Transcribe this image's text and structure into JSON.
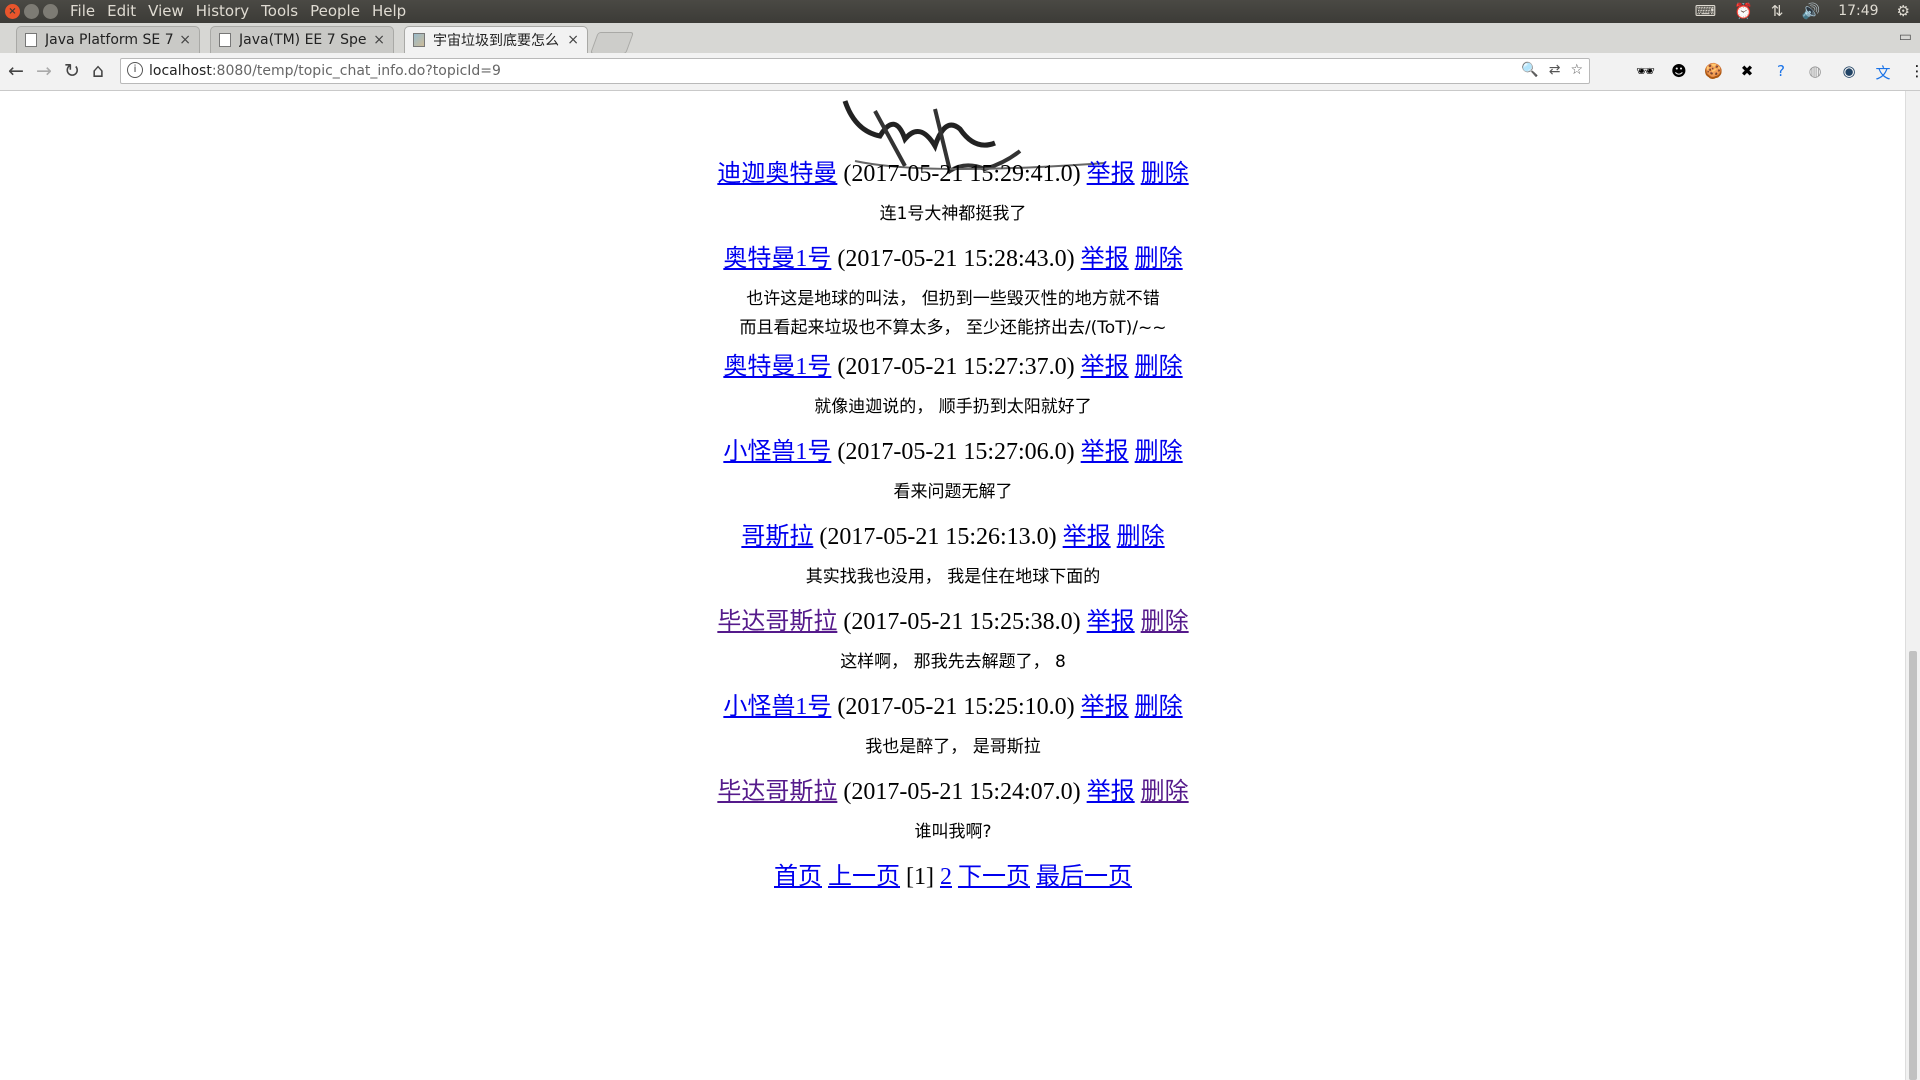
{
  "system": {
    "menus": [
      "File",
      "Edit",
      "View",
      "History",
      "Tools",
      "People",
      "Help"
    ],
    "clock": "17:49"
  },
  "tabs": [
    {
      "title": "Java Platform SE 7"
    },
    {
      "title": "Java(TM) EE 7 Spec"
    },
    {
      "title": "宇宙垃圾到底要怎么"
    }
  ],
  "address": {
    "host": "localhost",
    "rest": ":8080/temp/topic_chat_info.do?topicId=9"
  },
  "page": {
    "report_label": "举报",
    "delete_label": "删除",
    "posts": [
      {
        "author": "迪迦奥特曼",
        "time": "(2017-05-21 15:29:41.0)",
        "lines": [
          "连1号大神都挺我了"
        ]
      },
      {
        "author": "奥特曼1号",
        "time": "(2017-05-21 15:28:43.0)",
        "lines": [
          "也许这是地球的叫法， 但扔到一些毁灭性的地方就不错",
          "而且看起来垃圾也不算太多， 至少还能挤出去/(ToT)/~~"
        ]
      },
      {
        "author": "奥特曼1号",
        "time": "(2017-05-21 15:27:37.0)",
        "lines": [
          "就像迪迦说的， 顺手扔到太阳就好了"
        ]
      },
      {
        "author": "小怪兽1号",
        "time": "(2017-05-21 15:27:06.0)",
        "lines": [
          "看来问题无解了"
        ]
      },
      {
        "author": "哥斯拉",
        "time": "(2017-05-21 15:26:13.0)",
        "lines": [
          "其实找我也没用， 我是住在地球下面的"
        ]
      },
      {
        "author": "毕达哥斯拉",
        "time": "(2017-05-21 15:25:38.0)",
        "lines": [
          "这样啊， 那我先去解题了， 8"
        ]
      },
      {
        "author": "小怪兽1号",
        "time": "(2017-05-21 15:25:10.0)",
        "lines": [
          "我也是醉了， 是哥斯拉"
        ]
      },
      {
        "author": "毕达哥斯拉",
        "time": "(2017-05-21 15:24:07.0)",
        "lines": [
          "谁叫我啊?"
        ]
      }
    ],
    "pager": {
      "first": "首页",
      "prev": "上一页",
      "current": "[1]",
      "page2": "2",
      "next": "下一页",
      "last": "最后一页"
    }
  }
}
